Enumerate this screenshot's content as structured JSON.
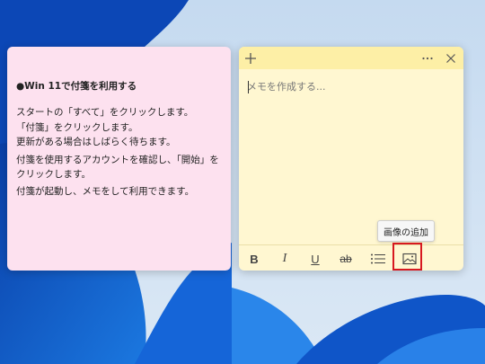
{
  "pink_note": {
    "heading": "●Win 11で付箋を利用する",
    "lines": [
      "スタートの「すべて」をクリックします。",
      "「付箋」をクリックします。",
      "更新がある場合はしばらく待ちます。",
      "付箋を使用するアカウントを確認し、「開始」をクリックします。",
      "付箋が起動し、メモをして利用できます。"
    ]
  },
  "yellow_note": {
    "placeholder": "メモを作成する...",
    "tooltip": "画像の追加",
    "toolbar": {
      "bold": "B",
      "italic": "I",
      "underline": "U",
      "strike": "ab"
    }
  },
  "colors": {
    "pink_note_bg": "#fde1ef",
    "yellow_note_bg": "#fff7d1",
    "yellow_titlebar": "#fdefa6",
    "highlight": "#d71920"
  },
  "icons": {
    "titlebar": [
      "plus-icon",
      "more-icon",
      "close-icon"
    ],
    "toolbar": [
      "bulleted-list-icon",
      "add-image-icon"
    ]
  }
}
